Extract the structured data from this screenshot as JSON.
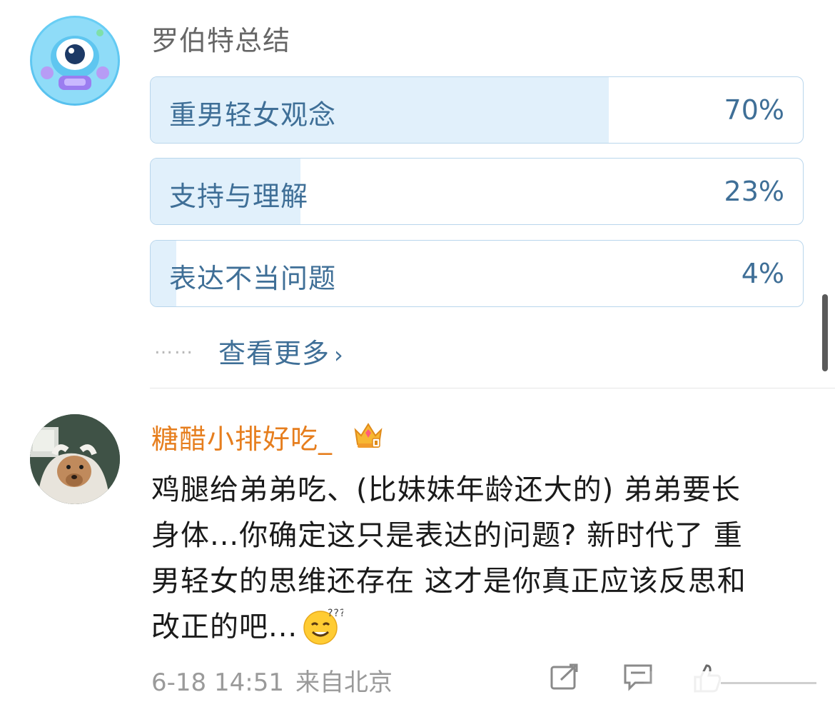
{
  "poll": {
    "title": "罗伯特总结",
    "options": [
      {
        "label": "重男轻女观念",
        "percent": "70%",
        "fill": 0.7
      },
      {
        "label": "支持与理解",
        "percent": "23%",
        "fill": 0.23
      },
      {
        "label": "表达不当问题",
        "percent": "4%",
        "fill": 0.04
      }
    ],
    "more_dots": "……",
    "view_more": "查看更多",
    "chevron": "›"
  },
  "comment": {
    "username": "糖醋小排好吃_",
    "lines": [
      "鸡腿给弟弟吃、(比妹妹年龄还大的) 弟弟要长",
      "身体...你确定这只是表达的问题? 新时代了 重",
      "男轻女的思维还存在 这才是你真正应该反思和",
      "改正的吧..."
    ],
    "date": "6-18 14:51",
    "source": "来自北京"
  },
  "colors": {
    "poll_text": "#3f6f97",
    "poll_fill": "#e1f0fb",
    "poll_border": "#b9d6ec",
    "username": "#e67e1e",
    "meta": "#9a9a9a"
  },
  "icons": [
    "robot-avatar",
    "crown-badge-icon",
    "sweat-smile-emoji",
    "share-icon",
    "comment-icon",
    "like-icon"
  ]
}
